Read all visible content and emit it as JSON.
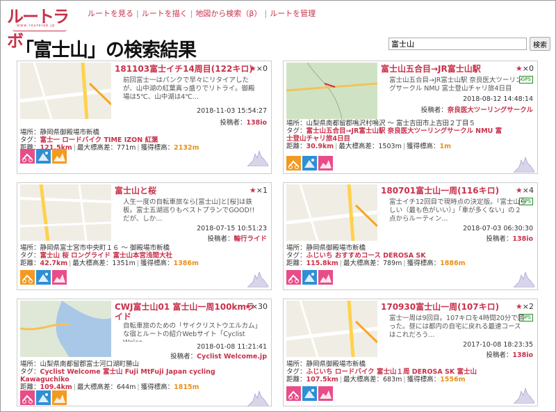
{
  "site": {
    "logo_text": "ルートラボ",
    "logo_sub": "www.routelab.jp"
  },
  "nav": {
    "items": [
      "ルートを見る",
      "ルートを描く",
      "地図から検索（β）",
      "ルートを管理"
    ]
  },
  "page": {
    "title": "「富士山」の検索結果"
  },
  "search": {
    "value": "富士山",
    "button": "検索"
  },
  "labels": {
    "place": "場所：",
    "tag": "タグ：",
    "distance": "距離：",
    "max_elev": "最大標高差：",
    "climb": "獲得標高："
  },
  "cards": [
    {
      "title": "181103富士イチ14周目(122キロ)",
      "stars": "×0",
      "badge": "",
      "desc": "前回富士一はパンクで早々にリタイアしたが、山中湖の紅葉真っ盛りでリトライ。御殿場は5℃、山中湖は4℃...",
      "date": "2018-11-03 15:54:27",
      "poster_label": "投稿者：",
      "poster": "138io",
      "place": "静岡県御殿場市新橋",
      "tags": "富士一 ロードバイク TIME IZON 紅葉",
      "distance": "121.5km",
      "max_elev": "771m",
      "climb": "2132m",
      "icon_colors": [
        "#e84d8a",
        "#2e8fd6",
        "#f29a21"
      ]
    },
    {
      "title": "富士山五合目→JR富士山駅",
      "stars": "×0",
      "badge": "GPS",
      "desc": "富士山五合目→JR富士山駅 奈良医大ツーリングサークル NMU 富士登山チャリ旅4日目",
      "date": "2018-08-12 14:48:14",
      "poster_label": "投稿者：",
      "poster": "奈良医大ツーリングサークル",
      "place": "山梨県南都留郡鳴沢村鳴沢 〜 富士吉田市上吉田２丁目５",
      "tags": "富士山五合目→JR富士山駅 奈良医大ツーリングサークル NMU 富士登山チャリ旅4日目",
      "distance": "30.9km",
      "max_elev": "1503m",
      "climb": "1m",
      "icon_colors": [
        "#f29a21",
        "#2e8fd6",
        "#e84d8a"
      ]
    },
    {
      "title": "富士山と桜",
      "stars": "×1",
      "badge": "",
      "desc": "人生一度の自転車旅なら[富士山]と[桜]は鉄板。富士五湖巡りもベストプランでGOOD!!だが、しか...",
      "date": "2018-07-15 10:51:23",
      "poster_label": "投稿者：",
      "poster": "輪行ライド",
      "place": "静岡県富士宮市中央町１６ 〜 御殿場市新橋",
      "tags": "富士山 桜 ロングライド 富士山本宮浅間大社",
      "distance": "42.7km",
      "max_elev": "1351m",
      "climb": "1386m",
      "icon_colors": [
        "#f29a21",
        "#2e8fd6",
        "#e84d8a"
      ]
    },
    {
      "title": "180701富士山一周(116キロ)",
      "stars": "×4",
      "badge": "GPS",
      "desc": "富士イチ12回目で現時点の決定版。「富士山らしい（最も色がいい）」「車が多くない」の２点からルーティン...",
      "date": "2018-07-03 06:30:30",
      "poster_label": "投稿者：",
      "poster": "138io",
      "place": "静岡県御殿場市新橋",
      "tags": "ふじいち おすすめコース DEROSA SK",
      "distance": "115.8km",
      "max_elev": "789m",
      "climb": "1886m",
      "icon_colors": [
        "#e84d8a",
        "#2e8fd6",
        "#e84d8a"
      ]
    },
    {
      "title": "CWJ富士山01 富士山一周100kmライド",
      "stars": "×30",
      "badge": "",
      "desc": "自転車旅のための「サイクリストウエルカム」な宿とルートの紹介Webサイト「Cyclist Welco...",
      "date": "2018-01-08 11:21:41",
      "poster_label": "投稿者：",
      "poster": "Cyclist Welcome.jp",
      "place": "山梨県南都留郡富士河口湖町勝山",
      "tags": "Cyclist Welcome 富士山 Fuji MtFuji Japan cycling Kawaguchiko",
      "distance": "109.4km",
      "max_elev": "644m",
      "climb": "1815m",
      "icon_colors": [
        "#e84d8a",
        "#2e8fd6",
        "#f29a21"
      ]
    },
    {
      "title": "170930富士山一周(107キロ)",
      "stars": "×2",
      "badge": "GPS",
      "desc": "富士一周は9回目。107キロを4時間20分で回った。昼には都内の自宅に戻れる最速コースはこれだろう...",
      "date": "2017-10-08 18:23:35",
      "poster_label": "投稿者：",
      "poster": "138io",
      "place": "静岡県御殿場市新橋",
      "tags": "ふじいち ロードバイク 富士山１周 DEROSA SK 富士山",
      "distance": "107.5km",
      "max_elev": "683m",
      "climb": "1556m",
      "icon_colors": [
        "#e84d8a",
        "#2e8fd6",
        "#e84d8a"
      ]
    }
  ]
}
